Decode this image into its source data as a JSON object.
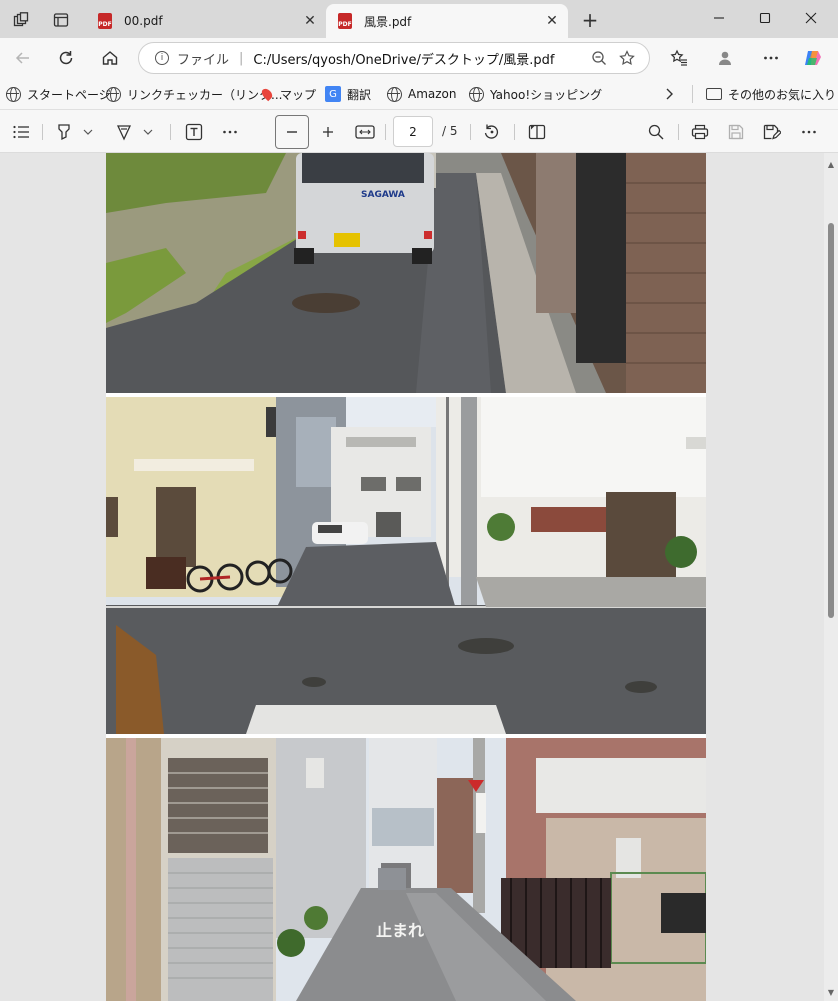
{
  "tabs": [
    {
      "title": "00.pdf",
      "active": false
    },
    {
      "title": "風景.pdf",
      "active": true
    }
  ],
  "address": {
    "protocol_label": "ファイル",
    "url": "C:/Users/qyosh/OneDrive/デスクトップ/風景.pdf"
  },
  "favorites": [
    {
      "label": "スタートページ",
      "icon": "globe-icon"
    },
    {
      "label": "リンクチェッカー（リンク...",
      "icon": "globe-icon"
    },
    {
      "label": "マップ",
      "icon": "map-pin-icon"
    },
    {
      "label": "翻訳",
      "icon": "translate-icon"
    },
    {
      "label": "Amazon",
      "icon": "globe-icon"
    },
    {
      "label": "Yahoo!ショッピング",
      "icon": "globe-icon"
    }
  ],
  "favorites_other": "その他のお気に入り",
  "pdf_toolbar": {
    "current_page": "2",
    "total_pages": "/ 5"
  },
  "colors": {
    "tabstrip_bg": "#d9d9d9",
    "toolbar_bg": "#f7f7f7",
    "doc_bg": "#e5e5e5",
    "pdf_icon_red": "#c62828"
  }
}
